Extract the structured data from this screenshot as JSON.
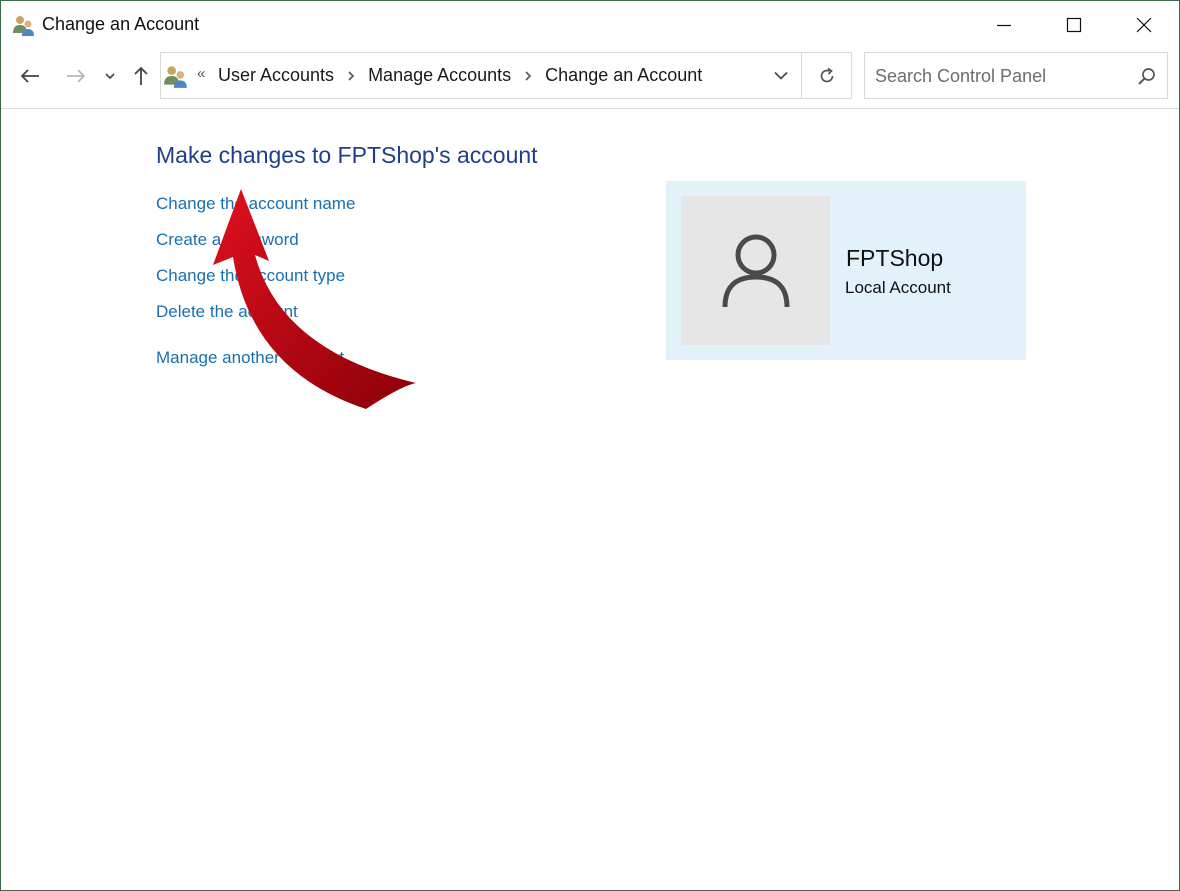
{
  "window": {
    "title": "Change an Account",
    "icon": "user-accounts-icon"
  },
  "nav": {
    "back": "back-arrow-icon",
    "forward": "forward-arrow-icon",
    "recent": "chevron-down-icon",
    "up": "up-arrow-icon"
  },
  "address": {
    "overflow": "«",
    "crumbs": [
      "User Accounts",
      "Manage Accounts",
      "Change an Account"
    ]
  },
  "search": {
    "placeholder": "Search Control Panel",
    "value": ""
  },
  "content": {
    "heading": "Make changes to FPTShop's account",
    "tasks": [
      "Change the account name",
      "Create a password",
      "Change the account type",
      "Delete the account",
      "Manage another account"
    ]
  },
  "account": {
    "name": "FPTShop",
    "type": "Local Account"
  },
  "colors": {
    "heading": "#1e3f8a",
    "link": "#1a6fb0",
    "card_bg": "#e3f1fb",
    "avatar_bg": "#e6e6e6",
    "arrow": "#b00010"
  }
}
